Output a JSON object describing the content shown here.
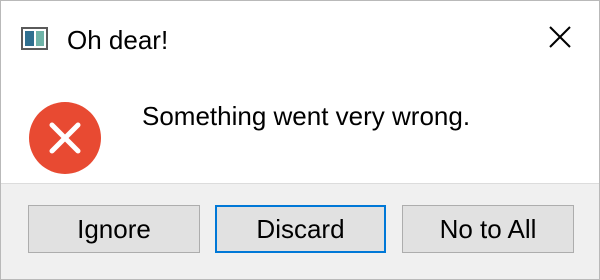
{
  "window": {
    "title": "Oh dear!",
    "app_icon": "application-window-icon",
    "close_icon": "close-icon"
  },
  "content": {
    "icon": "error-icon",
    "message": "Something went very wrong."
  },
  "buttons": [
    {
      "label": "Ignore",
      "default": false
    },
    {
      "label": "Discard",
      "default": true
    },
    {
      "label": "No to All",
      "default": false
    }
  ],
  "colors": {
    "error_red": "#e84a32",
    "focus_blue": "#0078d7",
    "button_face": "#e1e1e1",
    "button_bar": "#f0f0f0"
  }
}
